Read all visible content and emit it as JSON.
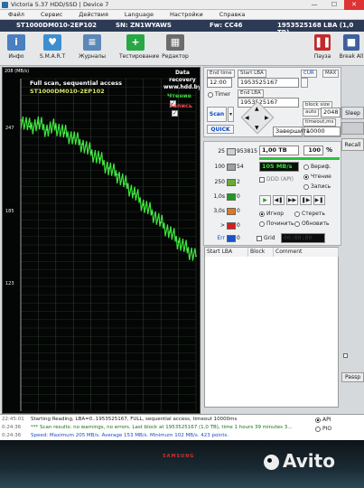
{
  "window": {
    "title": "Victoria 5.37 HDD/SSD | Device 7",
    "minimize": "—",
    "maximize": "☐",
    "close": "✕"
  },
  "menu": [
    "Файл",
    "Сервис",
    "Действия",
    "Language",
    "Настройки",
    "Справка"
  ],
  "drive": {
    "model": "ST1000DM010-2EP102",
    "serial": "SN: ZN1WYAWS",
    "firmware": "Fw: CC46",
    "capacity": "1953525168 LBA (1,0 TB)"
  },
  "toolbar": {
    "info": "Инфо",
    "smart": "S.M.A.R.T",
    "journals": "Журналы",
    "testing": "Тестирование",
    "editor": "Редактор",
    "pause": "Пауза",
    "break": "Break All"
  },
  "graph": {
    "max_label": "208 (MB/s)",
    "title": "Full scan, sequential access",
    "model": "ST1000DM010-2EP102",
    "data_recovery_1": "Data recovery",
    "data_recovery_2": "www.hdd.by",
    "read_label": "Чтение",
    "write_label": "Запись",
    "yticks": [
      "247",
      "185",
      "123"
    ]
  },
  "chart_data": {
    "type": "line",
    "title": "Full scan, sequential access",
    "ylabel": "MB/s",
    "x_range_percent": [
      0,
      100
    ],
    "ylim": [
      0,
      208
    ],
    "series": [
      {
        "name": "Чтение",
        "x": [
          0,
          5,
          10,
          15,
          20,
          25,
          30,
          35,
          40,
          45,
          50,
          55,
          60,
          65,
          70,
          75,
          80,
          85,
          90,
          95,
          100
        ],
        "values": [
          182,
          178,
          180,
          176,
          178,
          174,
          171,
          167,
          162,
          158,
          152,
          148,
          142,
          136,
          129,
          124,
          118,
          112,
          106,
          101,
          97
        ]
      }
    ]
  },
  "controls": {
    "end_time_label": "End time",
    "start_lba_label": "Start LBA",
    "end_lba_label": "End LBA",
    "cur_label": "CUR",
    "max_label": "MAX",
    "time_value": "12:00",
    "start_lba": "1953525167",
    "end_lba": "1953525167",
    "timer_label": "Timer",
    "block_size_label": "block size",
    "auto_label": "auto",
    "block_size": "2048",
    "timeout_label": "timeout,ms",
    "timeout": "10000",
    "scan_label": "Scan",
    "quick_label": "QUICK",
    "finish_label": "Завершить",
    "sleep_label": "Sleep",
    "recall_label": "Recall"
  },
  "stats": {
    "rows": [
      {
        "ms": "25",
        "count": "953815",
        "color": "#d0d0d0"
      },
      {
        "ms": "100",
        "count": "54",
        "color": "#a0a0a0"
      },
      {
        "ms": "250",
        "count": "2",
        "color": "#6aaa3a"
      },
      {
        "ms": "1,0s",
        "count": "0",
        "color": "#1e9b1e"
      },
      {
        "ms": "3,0s",
        "count": "0",
        "color": "#e07a1c"
      },
      {
        "ms": ">",
        "count": "0",
        "color": "#d02020"
      },
      {
        "ms": "Err",
        "count": "0",
        "color": "#1c53c8"
      }
    ],
    "size": "1,00 TB",
    "percent": "100",
    "percent_sign": "%",
    "speed": "105 MB/s",
    "verify_label": "Вериф.",
    "read_label": "Чтение",
    "write_label": "Запись",
    "ddd_label": "DDD (API)",
    "ignore_label": "Игнор",
    "erase_label": "Стереть",
    "repair_label": "Починить",
    "refresh_label": "Обновить",
    "grid_label": "Grid",
    "grid_time": "00:00:00"
  },
  "table": {
    "col_start": "Start LBA",
    "col_block": "Block",
    "col_comment": "Comment"
  },
  "side": {
    "sound_label": "Звук",
    "passp_label": "Passp"
  },
  "log": [
    {
      "time": "22:45:01",
      "text": "Starting Reading, LBA=0..1953525167, FULL, sequential access, timeout 10000ms",
      "color": "#1a1a1a"
    },
    {
      "time": "0:24:36",
      "text": "*** Scan results: no warnings, no errors. Last block at 1953525167 (1,0 TB), time 1 hours 39 minutes 3...",
      "color": "#1a6e1a"
    },
    {
      "time": "0:24:36",
      "text": "Speed: Maximum 205 MB/s. Average 153 MB/s. Minimum 102 MB/s. 423 points.",
      "color": "#1c4fb8"
    }
  ],
  "log_side": {
    "api": "API",
    "pio": "PIO"
  },
  "monitor": {
    "brand": "SAMSUNG"
  },
  "watermark": "Avito"
}
